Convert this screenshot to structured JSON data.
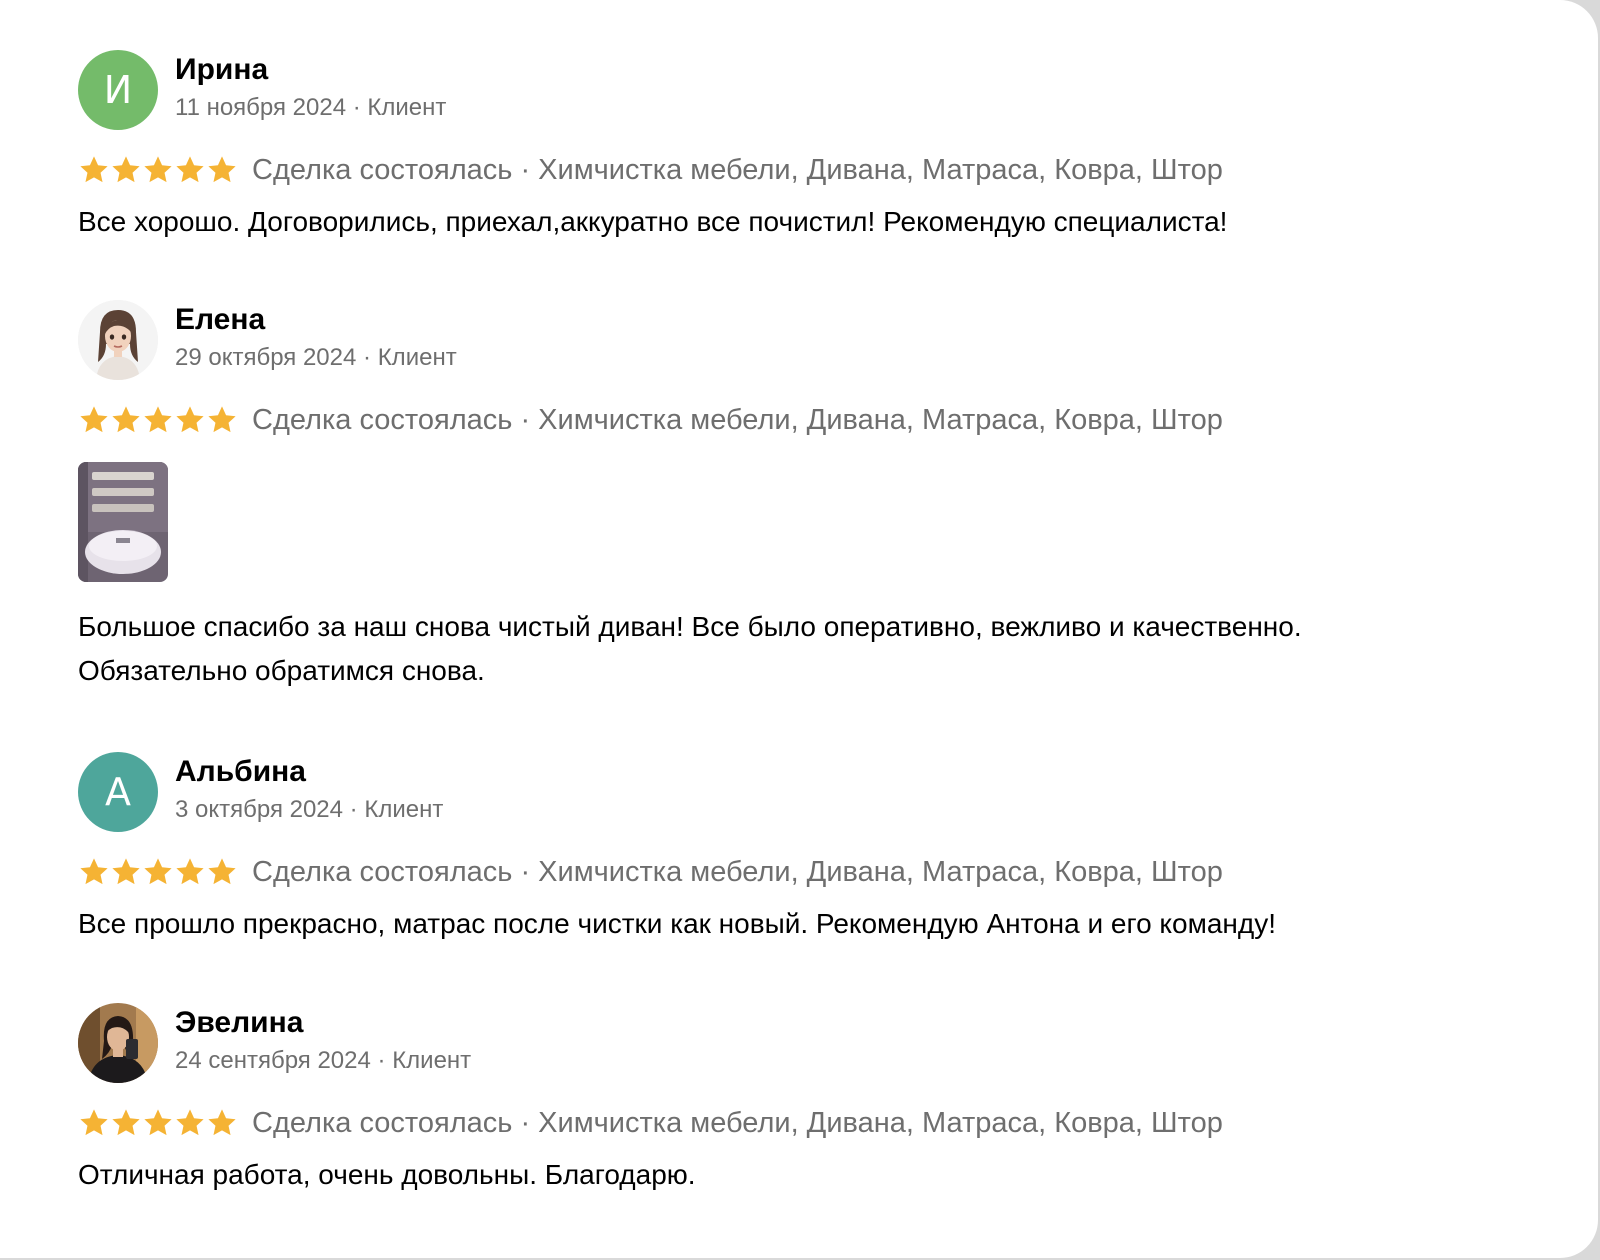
{
  "theme": {
    "star_color": "#f5b334",
    "muted_text": "#6e6e6e"
  },
  "reviews": [
    {
      "name": "Ирина",
      "avatar_letter": "И",
      "avatar_color": "#74bb6a",
      "date": "11 ноября 2024",
      "role": "Клиент",
      "rating": 5,
      "deal_status": "Сделка состоялась",
      "service": "Химчистка мебели, Дивана, Матраса, Ковра, Штор",
      "text": "Все хорошо. Договорились, приехал,аккуратно все почистил! Рекомендую специалиста!"
    },
    {
      "name": "Елена",
      "avatar_icon": "cartoon-woman-avatar",
      "date": "29 октября 2024",
      "role": "Клиент",
      "rating": 5,
      "deal_status": "Сделка состоялась",
      "service": "Химчистка мебели, Дивана, Матраса, Ковра, Штор",
      "photo_icon": "sofa-photo-thumbnail",
      "text_lines": [
        "Большое спасибо за наш снова чистый диван! Все было оперативно, вежливо и качественно.",
        "Обязательно обратимся снова."
      ]
    },
    {
      "name": "Альбина",
      "avatar_letter": "А",
      "avatar_color": "#4ea69b",
      "date": "3 октября 2024",
      "role": "Клиент",
      "rating": 5,
      "deal_status": "Сделка состоялась",
      "service": "Химчистка мебели, Дивана, Матраса, Ковра, Штор",
      "text": "Все прошло прекрасно, матрас после чистки как новый. Рекомендую Антона и его команду!"
    },
    {
      "name": "Эвелина",
      "avatar_icon": "user-photo-avatar",
      "date": "24 сентября 2024",
      "role": "Клиент",
      "rating": 5,
      "deal_status": "Сделка состоялась",
      "service": "Химчистка мебели, Дивана, Матраса, Ковра, Штор",
      "text": "Отличная работа, очень довольны. Благодарю."
    }
  ],
  "separator": "·"
}
